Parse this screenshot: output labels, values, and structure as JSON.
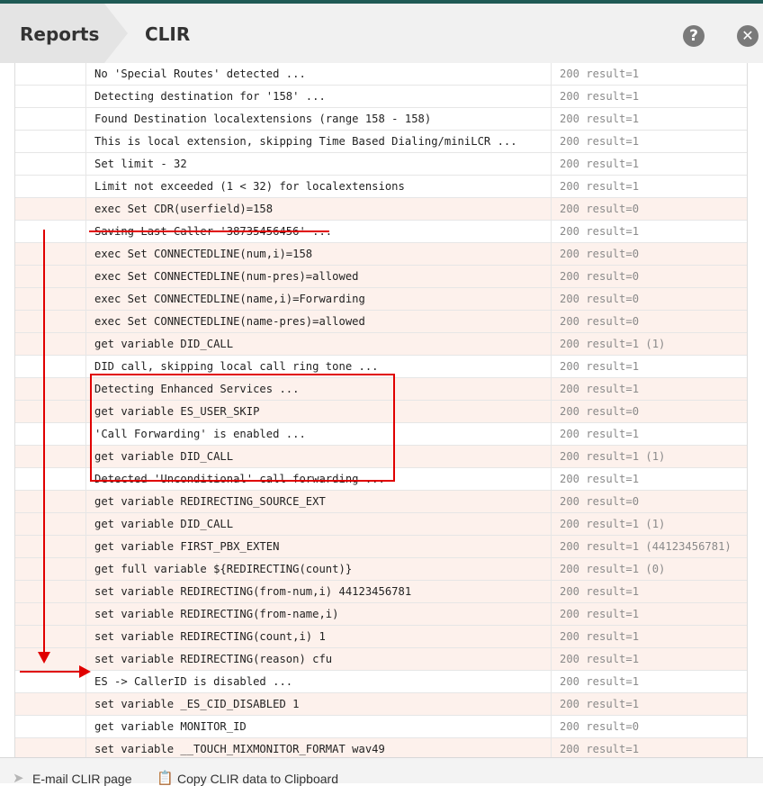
{
  "header": {
    "breadcrumb_root": "Reports",
    "title": "CLIR",
    "help_glyph": "?",
    "close_glyph": "✕"
  },
  "log": {
    "rows": [
      {
        "message": "No 'Special Routes' detected ...",
        "result": "200 result=1"
      },
      {
        "message": "Detecting destination for '158' ...",
        "result": "200 result=1"
      },
      {
        "message": "Found Destination localextensions (range 158 - 158)",
        "result": "200 result=1"
      },
      {
        "message": "This is local extension, skipping Time Based Dialing/miniLCR ...",
        "result": "200 result=1"
      },
      {
        "message": "Set limit - 32",
        "result": "200 result=1"
      },
      {
        "message": "Limit not exceeded (1 < 32) for localextensions",
        "result": "200 result=1"
      },
      {
        "message": "exec Set CDR(userfield)=158",
        "result": "200 result=0"
      },
      {
        "message": "Saving Last Caller '38735456456' ...",
        "result": "200 result=1"
      },
      {
        "message": "exec Set CONNECTEDLINE(num,i)=158",
        "result": "200 result=0"
      },
      {
        "message": "exec Set CONNECTEDLINE(num-pres)=allowed",
        "result": "200 result=0"
      },
      {
        "message": "exec Set CONNECTEDLINE(name,i)=Forwarding",
        "result": "200 result=0"
      },
      {
        "message": "exec Set CONNECTEDLINE(name-pres)=allowed",
        "result": "200 result=0"
      },
      {
        "message": "get variable DID_CALL",
        "result": "200 result=1 (1)"
      },
      {
        "message": "DID call, skipping local call ring tone ...",
        "result": "200 result=1"
      },
      {
        "message": "Detecting Enhanced Services ...",
        "result": "200 result=1"
      },
      {
        "message": "get variable ES_USER_SKIP",
        "result": "200 result=0"
      },
      {
        "message": "'Call Forwarding' is enabled ...",
        "result": "200 result=1"
      },
      {
        "message": "get variable DID_CALL",
        "result": "200 result=1 (1)"
      },
      {
        "message": "Detected 'Unconditional' call forwarding ...",
        "result": "200 result=1"
      },
      {
        "message": "get variable REDIRECTING_SOURCE_EXT",
        "result": "200 result=0"
      },
      {
        "message": "get variable DID_CALL",
        "result": "200 result=1 (1)"
      },
      {
        "message": "get variable FIRST_PBX_EXTEN",
        "result": "200 result=1 (44123456781)"
      },
      {
        "message": "get full variable ${REDIRECTING(count)}",
        "result": "200 result=1 (0)"
      },
      {
        "message": "set variable REDIRECTING(from-num,i) 44123456781",
        "result": "200 result=1"
      },
      {
        "message": "set variable REDIRECTING(from-name,i)",
        "result": "200 result=1"
      },
      {
        "message": "set variable REDIRECTING(count,i) 1",
        "result": "200 result=1"
      },
      {
        "message": "set variable REDIRECTING(reason) cfu",
        "result": "200 result=1"
      },
      {
        "message": "ES -> CallerID is disabled ...",
        "result": "200 result=1"
      },
      {
        "message": "set variable _ES_CID_DISABLED 1",
        "result": "200 result=1"
      },
      {
        "message": "get variable MONITOR_ID",
        "result": "200 result=0"
      },
      {
        "message": "set variable __TOUCH_MIXMONITOR_FORMAT wav49",
        "result": "200 result=1"
      }
    ]
  },
  "footer": {
    "email_label": "E-mail CLIR page",
    "copy_label": "Copy CLIR data to Clipboard",
    "email_icon": "paper-plane-icon",
    "copy_icon": "clipboard-icon"
  },
  "colors": {
    "row_highlight": "#fdf1ec",
    "annotation_red": "#e00000",
    "top_bar": "#1f5a55"
  }
}
